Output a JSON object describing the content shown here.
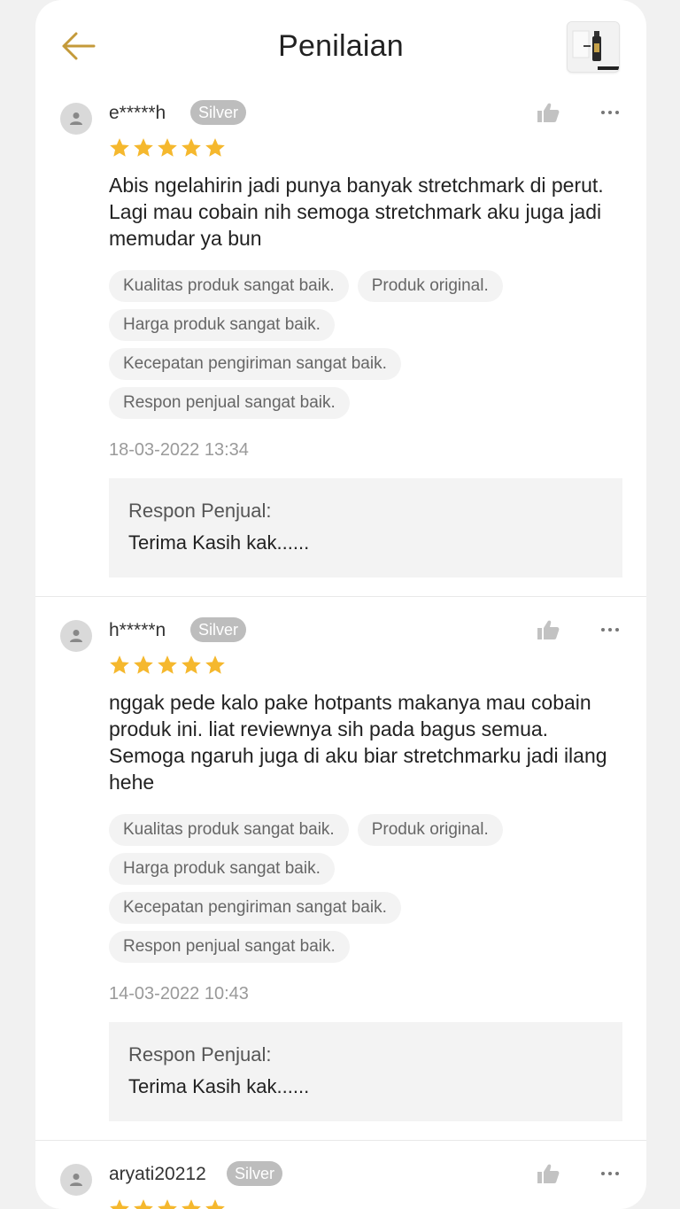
{
  "header": {
    "title": "Penilaian"
  },
  "colors": {
    "accent": "#c49a3a",
    "star": "#f5b82e",
    "badge": "#bdbdbd"
  },
  "icons": {
    "back": "arrow-left-icon",
    "like": "thumb-up-icon",
    "more": "ellipsis-icon",
    "avatar": "person-icon",
    "star": "star-icon"
  },
  "reviews": [
    {
      "username": "e*****h",
      "badge": "Silver",
      "rating": 5,
      "text": "Abis ngelahirin jadi punya banyak stretchmark di perut. Lagi mau cobain nih semoga stretchmark aku juga jadi memudar ya bun",
      "tags": [
        "Kualitas produk sangat baik.",
        "Produk original.",
        "Harga produk sangat baik.",
        "Kecepatan pengiriman sangat baik.",
        "Respon penjual sangat baik."
      ],
      "date": "18-03-2022 13:34",
      "seller_label": "Respon Penjual:",
      "seller_text": "Terima Kasih kak......"
    },
    {
      "username": "h*****n",
      "badge": "Silver",
      "rating": 5,
      "text": "nggak pede kalo pake hotpants makanya mau cobain produk ini. liat reviewnya sih pada bagus semua. Semoga ngaruh juga di aku biar stretchmarku jadi ilang hehe",
      "tags": [
        "Kualitas produk sangat baik.",
        "Produk original.",
        "Harga produk sangat baik.",
        "Kecepatan pengiriman sangat baik.",
        "Respon penjual sangat baik."
      ],
      "date": "14-03-2022 10:43",
      "seller_label": "Respon Penjual:",
      "seller_text": "Terima Kasih kak......"
    },
    {
      "username": "aryati20212",
      "badge": "Silver",
      "rating": 5
    }
  ]
}
